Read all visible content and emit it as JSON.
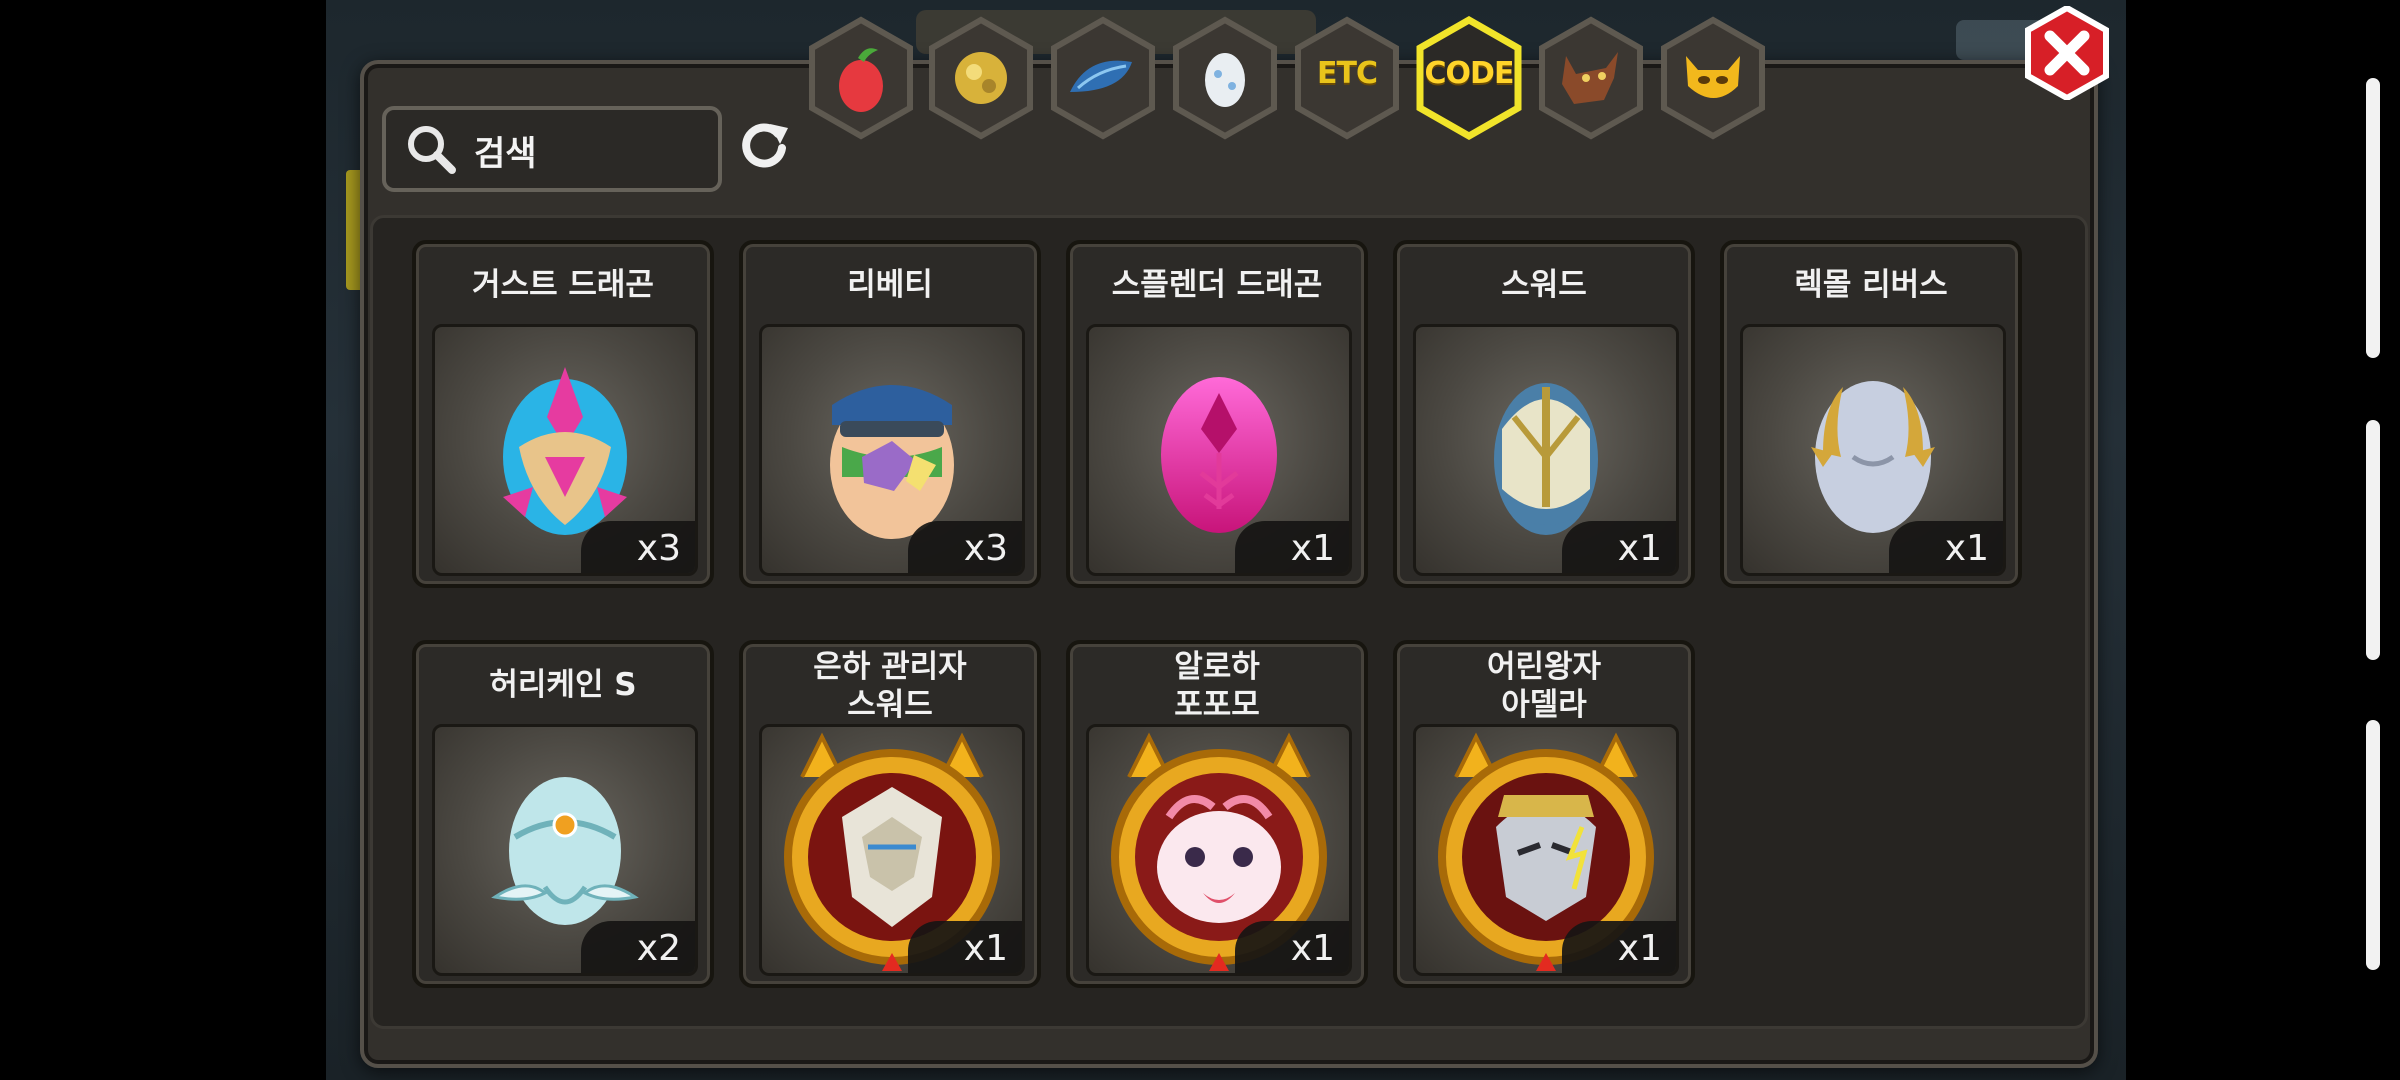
{
  "search": {
    "label": "검색"
  },
  "tabs": [
    {
      "icon": "fruit-icon",
      "label": ""
    },
    {
      "icon": "gold-ore-icon",
      "label": ""
    },
    {
      "icon": "blue-feather-icon",
      "label": ""
    },
    {
      "icon": "egg-icon",
      "label": ""
    },
    {
      "icon": "etc-icon",
      "label": "ETC"
    },
    {
      "icon": "code-icon",
      "label": "CODE",
      "active": true
    },
    {
      "icon": "werewolf-icon",
      "label": ""
    },
    {
      "icon": "yellow-creature-icon",
      "label": ""
    }
  ],
  "items": [
    {
      "name": "거스트 드래곤",
      "count": "x3",
      "icon": "gust-dragon-egg-icon",
      "colors": [
        "#e63ba0",
        "#2ab4e6",
        "#e8c48a"
      ]
    },
    {
      "name": "리베티",
      "count": "x3",
      "icon": "libety-egg-icon",
      "colors": [
        "#2d5f9e",
        "#f2c49a",
        "#9a6bc8"
      ]
    },
    {
      "name": "스플렌더 드래곤",
      "count": "x1",
      "icon": "splendor-dragon-egg-icon",
      "colors": [
        "#ff5ad2",
        "#e8259b",
        "#c8147a"
      ]
    },
    {
      "name": "스워드",
      "count": "x1",
      "icon": "sword-egg-icon",
      "colors": [
        "#4a7fa8",
        "#e8e4c8",
        "#b89a3a"
      ]
    },
    {
      "name": "렉몰 리버스",
      "count": "x1",
      "icon": "rekmol-reverse-egg-icon",
      "colors": [
        "#c7cfe0",
        "#8c95a8",
        "#d4a73a"
      ]
    },
    {
      "name": "허리케인 S",
      "count": "x2",
      "icon": "hurricane-s-egg-icon",
      "colors": [
        "#bfe6ea",
        "#6fb2ba",
        "#f0a020"
      ]
    },
    {
      "name_line1": "은하 관리자",
      "name_line2": "스워드",
      "count": "x1",
      "icon": "galaxy-manager-sword-portrait-icon"
    },
    {
      "name_line1": "알로하",
      "name_line2": "포포모",
      "count": "x1",
      "icon": "aloha-popomo-portrait-icon"
    },
    {
      "name_line1": "어린왕자",
      "name_line2": "아델라",
      "count": "x1",
      "icon": "little-prince-adela-portrait-icon"
    }
  ],
  "close": {
    "icon": "close-icon"
  }
}
